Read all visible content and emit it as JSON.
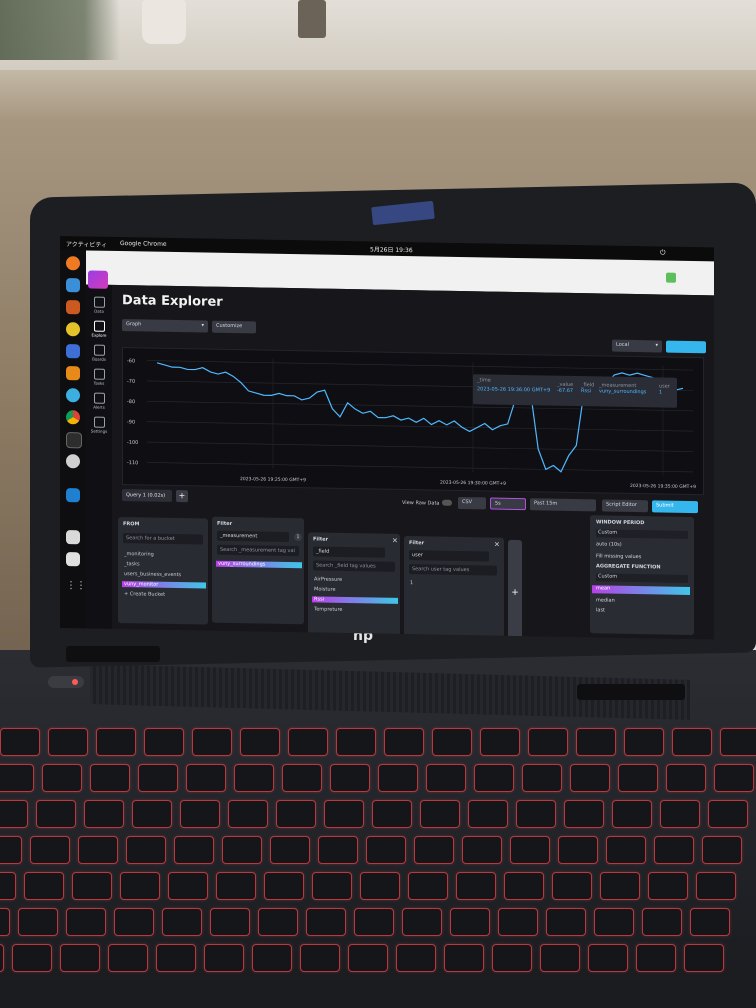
{
  "os_topbar": {
    "activities": "アクティビティ",
    "app": "Google Chrome",
    "clock": "5月26日 19:36"
  },
  "app_nav": [
    {
      "label": "Data"
    },
    {
      "label": "Explore"
    },
    {
      "label": "Boards"
    },
    {
      "label": "Tasks"
    },
    {
      "label": "Alerts"
    },
    {
      "label": "Settings"
    }
  ],
  "page": {
    "title": "Data Explorer"
  },
  "toolbar_top": {
    "graph_type": "Graph",
    "customize": "Customize",
    "timezone": "Local"
  },
  "chart_data": {
    "type": "line",
    "y_ticks": [
      "-60",
      "-70",
      "-80",
      "-90",
      "-100",
      "-110"
    ],
    "x_ticks": [
      "2023-05-26 19:25:00 GMT+9",
      "2023-05-26 19:30:00 GMT+9",
      "2023-05-26 19:35:00 GMT+9"
    ],
    "ylim": [
      -112,
      -58
    ],
    "series_color": "#4fb8ff",
    "values": [
      -61,
      -62,
      -63,
      -63,
      -64,
      -64,
      -63,
      -65,
      -66,
      -65,
      -67,
      -70,
      -74,
      -75,
      -76,
      -76,
      -75,
      -76,
      -76,
      -78,
      -77,
      -74,
      -73,
      -82,
      -86,
      -79,
      -82,
      -84,
      -83,
      -86,
      -86,
      -85,
      -87,
      -86,
      -88,
      -86,
      -89,
      -87,
      -89,
      -87,
      -90,
      -92,
      -90,
      -88,
      -91,
      -89,
      -88,
      -76,
      -70,
      -72,
      -100,
      -110,
      -108,
      -111,
      -103,
      -98,
      -72,
      -72,
      -68,
      -67,
      -63,
      -62,
      -63,
      -62,
      -63,
      -64,
      -66,
      -68,
      -70,
      -69
    ]
  },
  "tooltip": {
    "time_key": "_time",
    "time_val": "2023-05-26 19:36:00 GMT+9",
    "value_key": "_value",
    "value_val": "-67.67",
    "field_key": "_field",
    "field_val": "Rssi",
    "meas_key": "_measurement",
    "meas_val": "vuny_surroundings",
    "user_key": "user",
    "user_val": "1"
  },
  "query": {
    "tab": "Query 1 (0.02s)",
    "add": "+"
  },
  "actions": {
    "view_raw": "View Raw Data",
    "csv": "CSV",
    "refresh": "5s",
    "range": "Past 15m",
    "script_editor": "Script Editor",
    "submit": "Submit"
  },
  "from_card": {
    "header": "FROM",
    "search": "Search for a bucket",
    "buckets": [
      "_monitoring",
      "_tasks",
      "users_business_events",
      "vuny_monitor",
      "+ Create Bucket"
    ]
  },
  "filter1": {
    "header": "Filter",
    "key": "_measurement",
    "count": "1",
    "search": "Search _measurement tag val",
    "items": [
      "vuny_surroundings"
    ]
  },
  "filter2": {
    "header": "Filter",
    "key": "_field",
    "search": "Search _field tag values",
    "items": [
      "AirPressure",
      "Moisture",
      "Rssi",
      "Tempreture"
    ]
  },
  "filter3": {
    "header": "Filter",
    "key": "user",
    "search": "Search user tag values",
    "items": [
      "1"
    ]
  },
  "window_panel": {
    "title": "WINDOW PERIOD",
    "custom": "Custom",
    "auto": "auto (10s)",
    "fill": "Fill missing values",
    "agg_title": "AGGREGATE FUNCTION",
    "agg_custom": "Custom",
    "functions": [
      "mean",
      "median",
      "last"
    ]
  },
  "brand": "hp"
}
